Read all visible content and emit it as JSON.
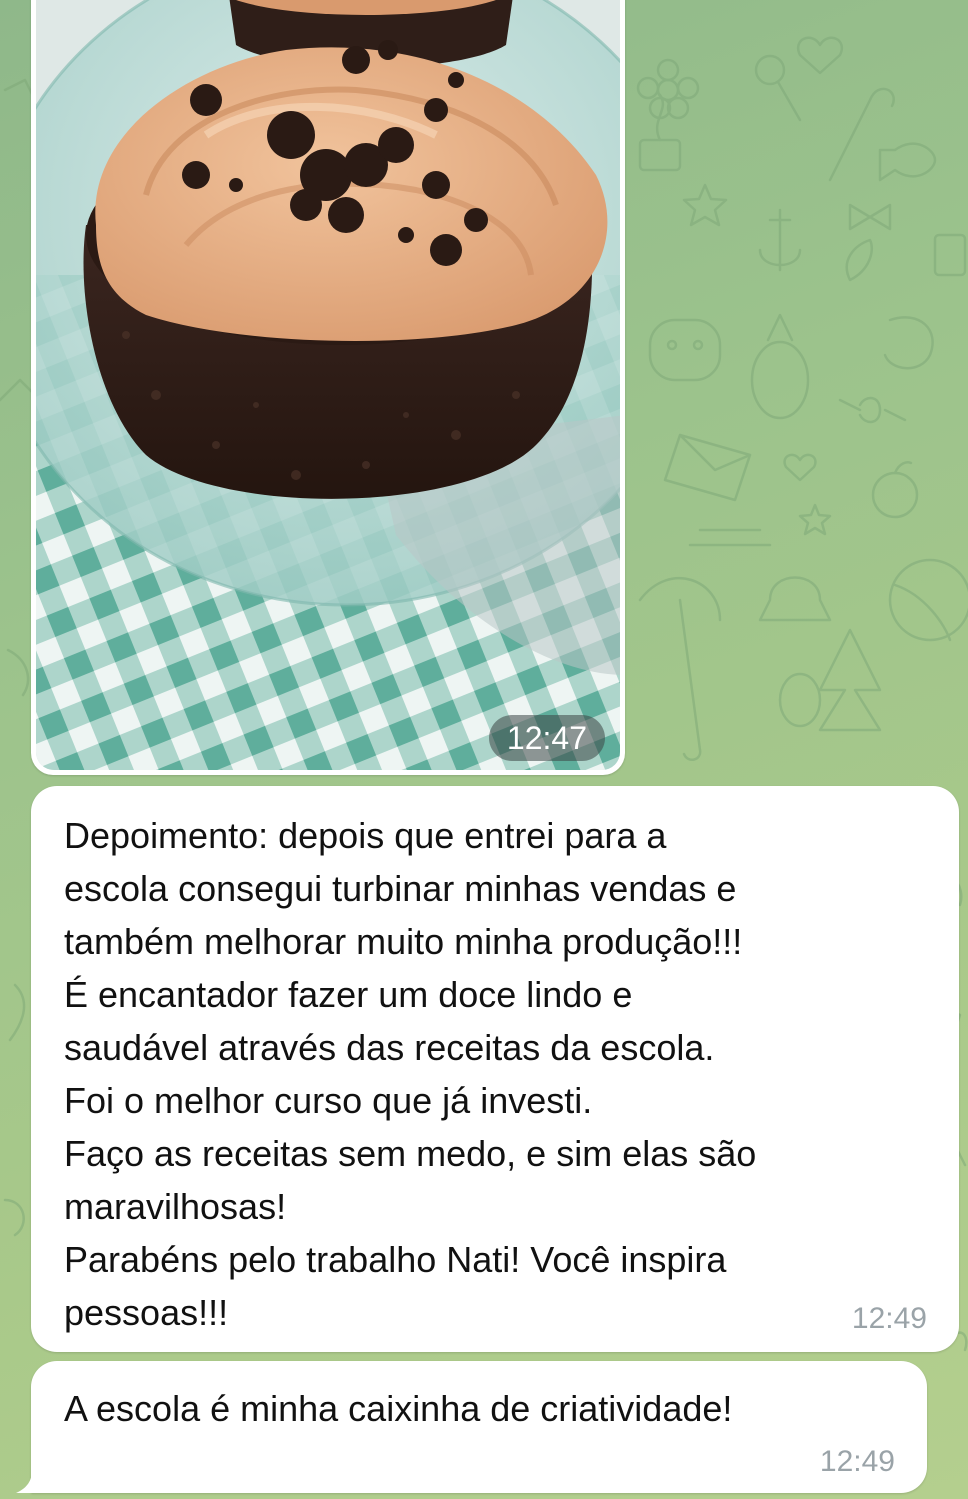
{
  "photo_message": {
    "time": "12:47"
  },
  "messages": [
    {
      "text": "Depoimento: depois que entrei para a\nescola consegui turbinar minhas vendas e\ntambém melhorar muito minha produção!!!\nÉ encantador fazer um doce lindo e\nsaudável através das receitas da escola.\nFoi o melhor curso que já investi.\nFaço as receitas sem medo, e sim elas são\nmaravilhosas!\nParabéns pelo trabalho Nati! Você inspira\npessoas!!!",
      "time": "12:49"
    },
    {
      "text": "A escola é minha caixinha de criatividade!",
      "time": "12:49"
    }
  ],
  "colors": {
    "background": "#9cc38c",
    "bubble": "#ffffff",
    "time_text": "#9aa3a8"
  }
}
